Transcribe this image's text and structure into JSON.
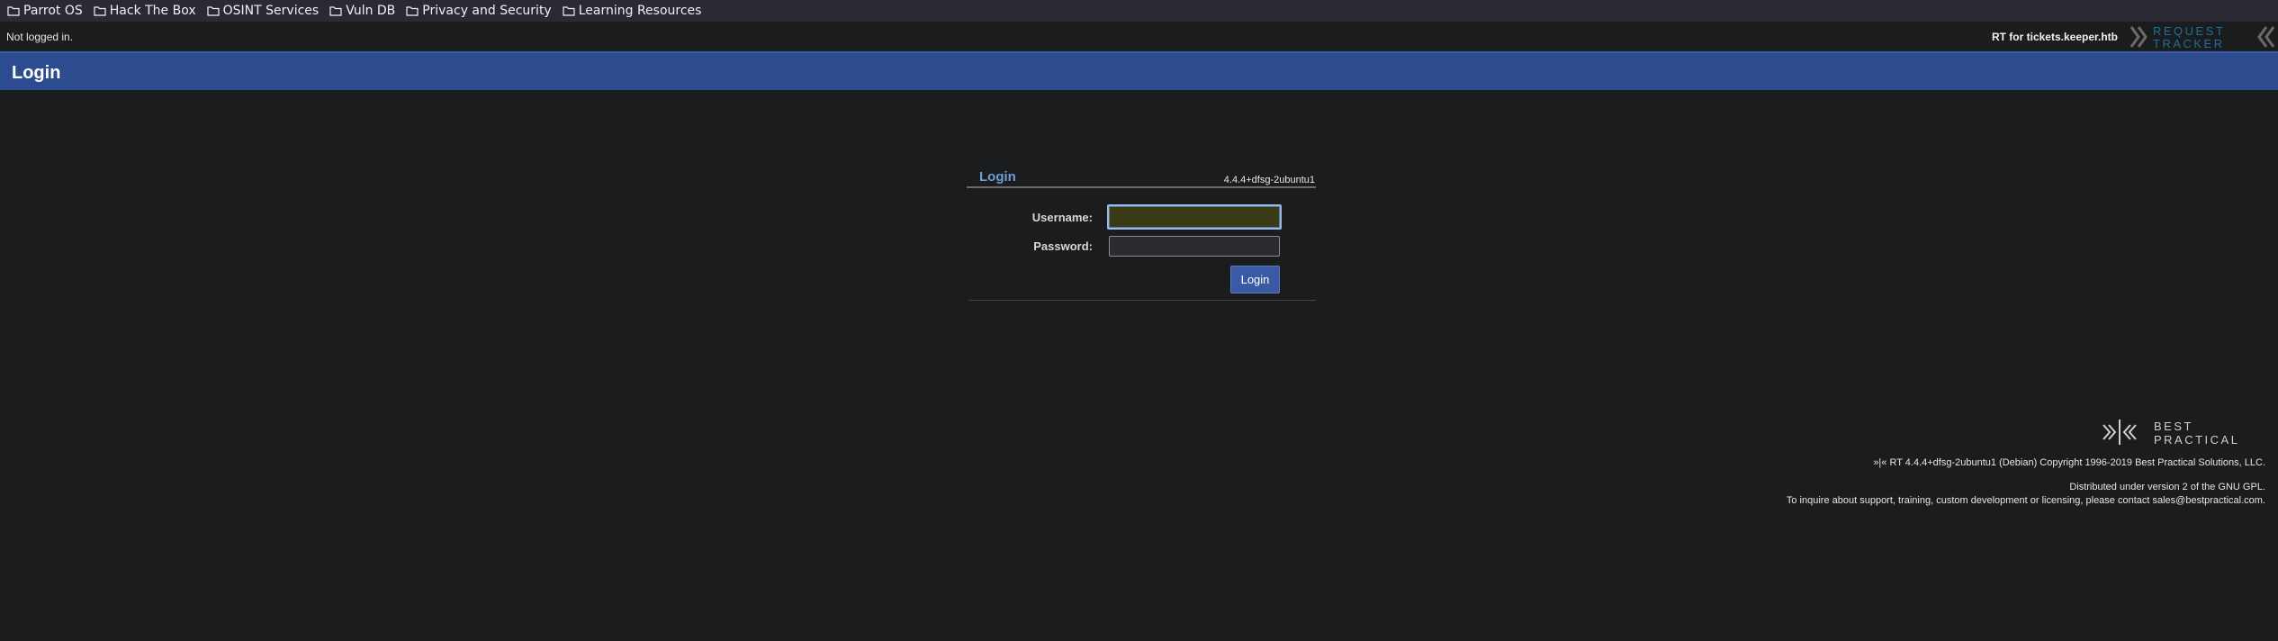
{
  "bookmarks": [
    {
      "label": "Parrot OS",
      "icon": "folder-icon"
    },
    {
      "label": "Hack The Box",
      "icon": "folder-icon"
    },
    {
      "label": "OSINT Services",
      "icon": "folder-icon"
    },
    {
      "label": "Vuln DB",
      "icon": "folder-icon"
    },
    {
      "label": "Privacy and Security",
      "icon": "folder-icon"
    },
    {
      "label": "Learning Resources",
      "icon": "folder-icon"
    }
  ],
  "topbar": {
    "status": "Not logged in.",
    "rt_for": "RT for tickets.keeper.htb",
    "logo_line1": "REQUEST",
    "logo_line2": "TRACKER"
  },
  "header": {
    "title": "Login"
  },
  "login": {
    "title": "Login",
    "version": "4.4.4+dfsg-2ubuntu1",
    "username_label": "Username:",
    "username_value": "",
    "password_label": "Password:",
    "password_value": "",
    "submit_label": "Login"
  },
  "footer": {
    "logo_line1": "BEST",
    "logo_line2": "PRACTICAL",
    "copyright": "»|« RT 4.4.4+dfsg-2ubuntu1 (Debian) Copyright 1996-2019 Best Practical Solutions, LLC.",
    "license": "Distributed under version 2 of the GNU GPL.",
    "contact": "To inquire about support, training, custom development or licensing, please contact sales@bestpractical.com."
  },
  "colors": {
    "background": "#1b1c1e",
    "header_blue": "#2c4c8f",
    "accent_link": "#6f9ed9",
    "button_blue": "#3a5aa6"
  }
}
